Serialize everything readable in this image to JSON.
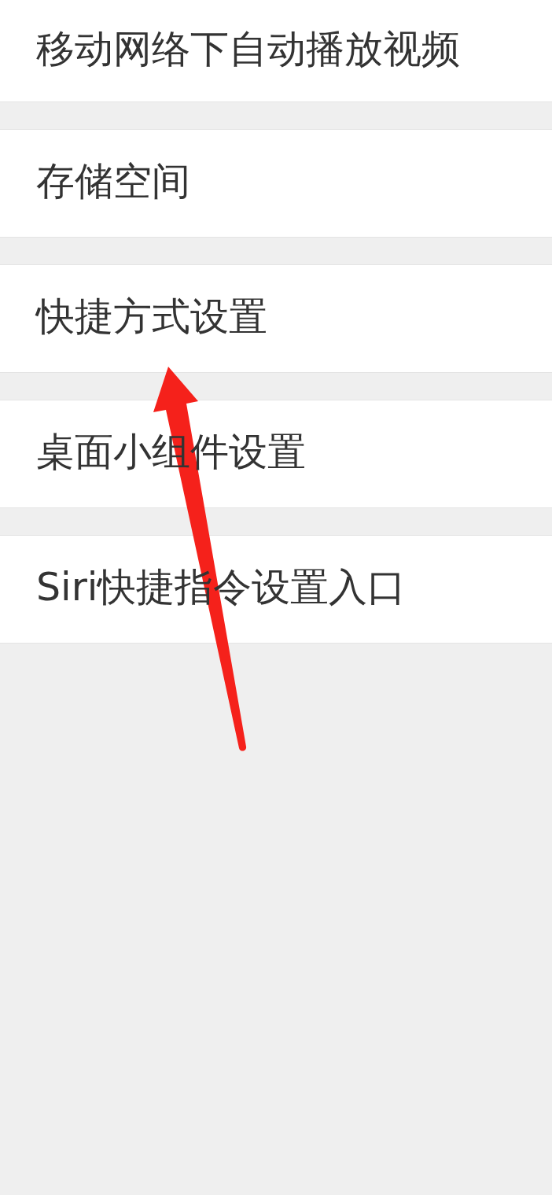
{
  "settings_items": [
    {
      "label": "移动网络下自动播放视频"
    },
    {
      "label": "存储空间"
    },
    {
      "label": "快捷方式设置"
    },
    {
      "label": "桌面小组件设置"
    },
    {
      "label": "Siri快捷指令设置入口"
    }
  ]
}
